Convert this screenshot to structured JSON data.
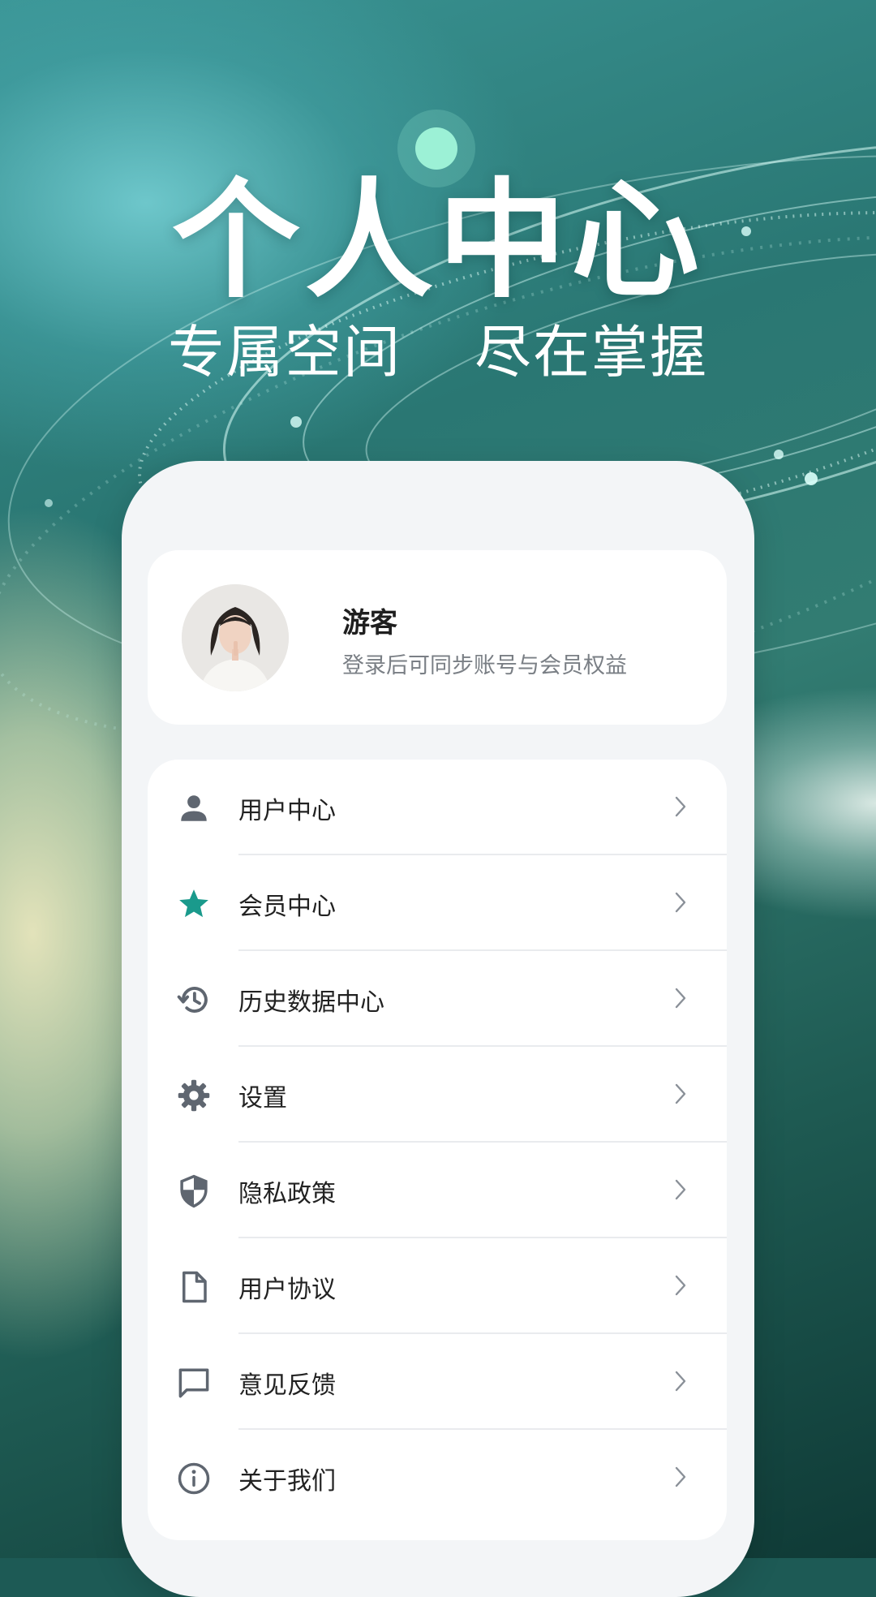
{
  "hero": {
    "title": "个人中心",
    "subtitle_left": "专属空间",
    "subtitle_right": "尽在掌握"
  },
  "profile": {
    "name": "游客",
    "description": "登录后可同步账号与会员权益"
  },
  "menu": {
    "items": [
      {
        "label": "用户中心",
        "icon": "person-icon"
      },
      {
        "label": "会员中心",
        "icon": "star-icon"
      },
      {
        "label": "历史数据中心",
        "icon": "history-icon"
      },
      {
        "label": "设置",
        "icon": "gear-icon"
      },
      {
        "label": "隐私政策",
        "icon": "shield-icon"
      },
      {
        "label": "用户协议",
        "icon": "document-icon"
      },
      {
        "label": "意见反馈",
        "icon": "chat-icon"
      },
      {
        "label": "关于我们",
        "icon": "info-icon"
      }
    ]
  },
  "colors": {
    "accent": "#1a9a8c",
    "icon_gray": "#5f6670",
    "card": "#ffffff",
    "panel": "#f3f5f7"
  }
}
